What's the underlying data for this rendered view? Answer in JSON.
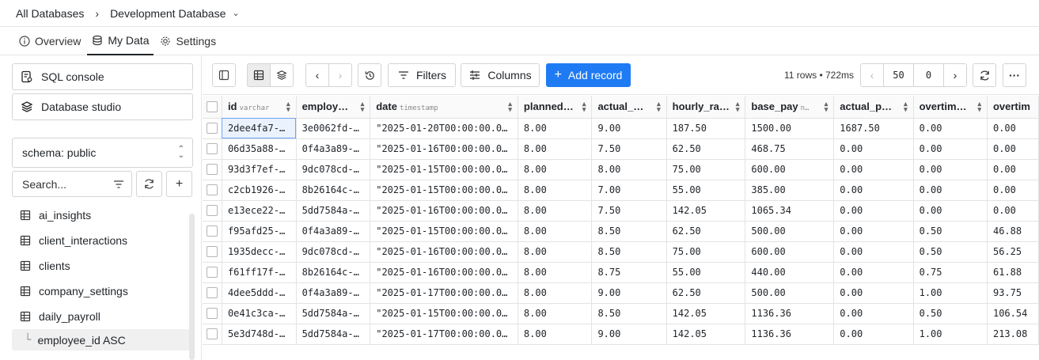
{
  "breadcrumb": {
    "root": "All Databases",
    "current": "Development Database"
  },
  "tabs": [
    {
      "label": "Overview",
      "icon": "info-icon"
    },
    {
      "label": "My Data",
      "icon": "database-icon"
    },
    {
      "label": "Settings",
      "icon": "gear-icon"
    }
  ],
  "sidebar": {
    "sql_console": "SQL console",
    "database_studio": "Database studio",
    "schema": "schema: public",
    "search_placeholder": "Search...",
    "tables": [
      "ai_insights",
      "client_interactions",
      "clients",
      "company_settings",
      "daily_payroll"
    ],
    "sort_item": "employee_id ASC"
  },
  "toolbar": {
    "filters": "Filters",
    "columns": "Columns",
    "add_record": "Add record",
    "meta": "11 rows • 722ms",
    "page_size": "50",
    "offset": "0",
    "accent_color": "#1f7bf4"
  },
  "grid": {
    "columns": [
      {
        "name": "id",
        "type": "varchar"
      },
      {
        "name": "employ…",
        "type": ""
      },
      {
        "name": "date",
        "type": "timestamp"
      },
      {
        "name": "planned…",
        "type": ""
      },
      {
        "name": "actual_…",
        "type": ""
      },
      {
        "name": "hourly_ra…",
        "type": ""
      },
      {
        "name": "base_pay",
        "type": "n…"
      },
      {
        "name": "actual_p…",
        "type": ""
      },
      {
        "name": "overtim…",
        "type": ""
      },
      {
        "name": "overtim",
        "type": ""
      }
    ],
    "rows": [
      [
        "2dee4fa7-…",
        "3e0062fd-…",
        "\"2025-01-20T00:00:00.0…",
        "8.00",
        "9.00",
        "187.50",
        "1500.00",
        "1687.50",
        "0.00",
        "0.00"
      ],
      [
        "06d35a88-…",
        "0f4a3a89-…",
        "\"2025-01-16T00:00:00.0…",
        "8.00",
        "7.50",
        "62.50",
        "468.75",
        "0.00",
        "0.00",
        "0.00"
      ],
      [
        "93d3f7ef-…",
        "9dc078cd-…",
        "\"2025-01-15T00:00:00.0…",
        "8.00",
        "8.00",
        "75.00",
        "600.00",
        "0.00",
        "0.00",
        "0.00"
      ],
      [
        "c2cb1926-…",
        "8b26164c-…",
        "\"2025-01-15T00:00:00.0…",
        "8.00",
        "7.00",
        "55.00",
        "385.00",
        "0.00",
        "0.00",
        "0.00"
      ],
      [
        "e13ece22-…",
        "5dd7584a-…",
        "\"2025-01-16T00:00:00.0…",
        "8.00",
        "7.50",
        "142.05",
        "1065.34",
        "0.00",
        "0.00",
        "0.00"
      ],
      [
        "f95afd25-…",
        "0f4a3a89-…",
        "\"2025-01-15T00:00:00.0…",
        "8.00",
        "8.50",
        "62.50",
        "500.00",
        "0.00",
        "0.50",
        "46.88"
      ],
      [
        "1935decc-…",
        "9dc078cd-…",
        "\"2025-01-16T00:00:00.0…",
        "8.00",
        "8.50",
        "75.00",
        "600.00",
        "0.00",
        "0.50",
        "56.25"
      ],
      [
        "f61ff17f-…",
        "8b26164c-…",
        "\"2025-01-16T00:00:00.0…",
        "8.00",
        "8.75",
        "55.00",
        "440.00",
        "0.00",
        "0.75",
        "61.88"
      ],
      [
        "4dee5ddd-…",
        "0f4a3a89-…",
        "\"2025-01-17T00:00:00.0…",
        "8.00",
        "9.00",
        "62.50",
        "500.00",
        "0.00",
        "1.00",
        "93.75"
      ],
      [
        "0e41c3ca-…",
        "5dd7584a-…",
        "\"2025-01-15T00:00:00.0…",
        "8.00",
        "8.50",
        "142.05",
        "1136.36",
        "0.00",
        "0.50",
        "106.54"
      ],
      [
        "5e3d748d-…",
        "5dd7584a-…",
        "\"2025-01-17T00:00:00.0…",
        "8.00",
        "9.00",
        "142.05",
        "1136.36",
        "0.00",
        "1.00",
        "213.08"
      ]
    ]
  }
}
